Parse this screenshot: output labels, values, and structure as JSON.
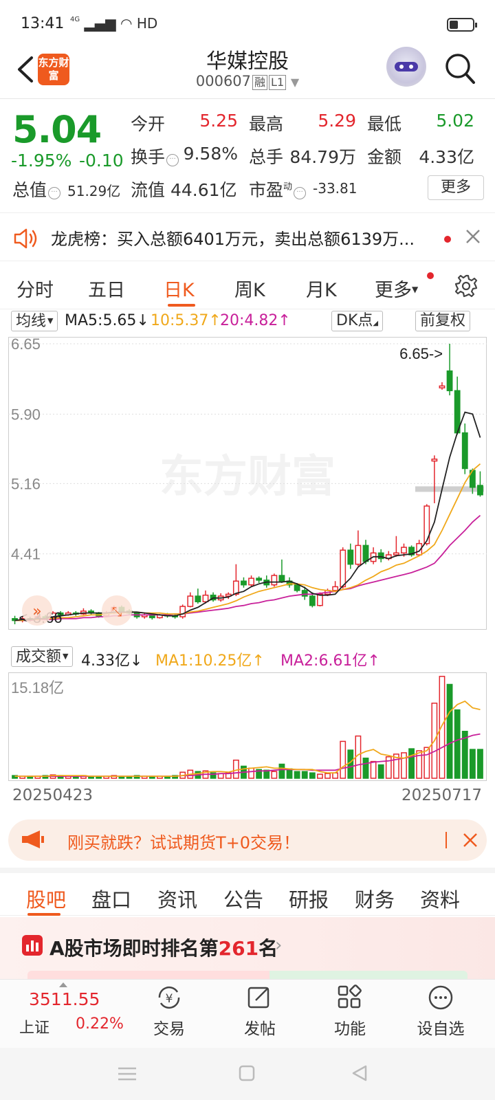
{
  "status_bar": {
    "time": "13:41",
    "network": "4G",
    "hd": "HD"
  },
  "header": {
    "logo_text": "东方财富",
    "stock_name": "华媒控股",
    "stock_code": "000607",
    "tag_rong": "融",
    "tag_level": "L1"
  },
  "quote": {
    "price": "5.04",
    "change_pct": "-1.95%",
    "change": "-0.10",
    "open_label": "今开",
    "open": "5.25",
    "high_label": "最高",
    "high": "5.29",
    "low_label": "最低",
    "low": "5.02",
    "turnover_label": "换手",
    "turnover": "9.58%",
    "volume_label": "总手",
    "volume": "84.79万",
    "amount_label": "金额",
    "amount": "4.33亿",
    "mktcap_label": "总值",
    "mktcap": "51.29亿",
    "float_label": "流值",
    "float_cap": "44.61亿",
    "pe_label": "市盈",
    "pe_sup": "动",
    "pe": "-33.81",
    "more_label": "更多"
  },
  "news": {
    "text": "龙虎榜：买入总额6401万元，卖出总额6139万..."
  },
  "period_tabs": [
    "分时",
    "五日",
    "日K",
    "周K",
    "月K",
    "更多"
  ],
  "ma_bar": {
    "indicator": "均线",
    "ma5": "MA5:5.65",
    "ma10": "10:5.37",
    "ma20": "20:4.82",
    "dk": "DK点",
    "adjust": "前复权",
    "ma5_color": "#222222",
    "ma10_color": "#f0a81a",
    "ma20_color": "#c8209a"
  },
  "chart": {
    "y_labels": [
      "6.65",
      "5.90",
      "5.16",
      "4.41"
    ],
    "max_label": "6.65",
    "min_label": "3.66",
    "watermark": "东方财富"
  },
  "volume_bar": {
    "indicator": "成交额",
    "value": "4.33亿",
    "ma1": "MA1:10.25亿",
    "ma2": "MA2:6.61亿",
    "max_label": "15.18亿"
  },
  "chart_data": {
    "type": "candlestick",
    "x_start": "20250423",
    "x_end": "20250717",
    "ylim": [
      3.66,
      6.65
    ],
    "candles": [
      [
        3.72,
        3.7,
        3.75,
        3.66
      ],
      [
        3.7,
        3.72,
        3.74,
        3.68
      ],
      [
        3.72,
        3.71,
        3.74,
        3.69
      ],
      [
        3.71,
        3.74,
        3.76,
        3.7
      ],
      [
        3.74,
        3.73,
        3.76,
        3.71
      ],
      [
        3.73,
        3.78,
        3.8,
        3.72
      ],
      [
        3.78,
        3.76,
        3.8,
        3.74
      ],
      [
        3.76,
        3.78,
        3.8,
        3.75
      ],
      [
        3.78,
        3.77,
        3.8,
        3.75
      ],
      [
        3.77,
        3.8,
        3.83,
        3.76
      ],
      [
        3.8,
        3.78,
        3.82,
        3.76
      ],
      [
        3.78,
        3.75,
        3.79,
        3.73
      ],
      [
        3.75,
        3.78,
        3.8,
        3.74
      ],
      [
        3.78,
        3.84,
        3.86,
        3.77
      ],
      [
        3.84,
        3.8,
        3.86,
        3.78
      ],
      [
        3.8,
        3.78,
        3.82,
        3.76
      ],
      [
        3.78,
        3.74,
        3.79,
        3.72
      ],
      [
        3.74,
        3.76,
        3.78,
        3.72
      ],
      [
        3.76,
        3.73,
        3.78,
        3.71
      ],
      [
        3.73,
        3.76,
        3.77,
        3.72
      ],
      [
        3.76,
        3.75,
        3.78,
        3.73
      ],
      [
        3.75,
        3.74,
        3.77,
        3.72
      ],
      [
        3.74,
        3.85,
        3.87,
        3.72
      ],
      [
        3.85,
        3.96,
        4.0,
        3.84
      ],
      [
        3.96,
        3.9,
        4.04,
        3.88
      ],
      [
        3.9,
        3.97,
        4.02,
        3.88
      ],
      [
        3.97,
        3.92,
        4.0,
        3.9
      ],
      [
        3.92,
        3.96,
        3.99,
        3.9
      ],
      [
        3.96,
        3.98,
        4.0,
        3.93
      ],
      [
        3.98,
        4.12,
        4.3,
        3.96
      ],
      [
        4.12,
        4.08,
        4.16,
        4.05
      ],
      [
        4.08,
        4.15,
        4.18,
        4.06
      ],
      [
        4.15,
        4.13,
        4.17,
        4.1
      ],
      [
        4.13,
        4.08,
        4.18,
        4.05
      ],
      [
        4.08,
        4.18,
        4.2,
        4.06
      ],
      [
        4.18,
        4.12,
        4.35,
        4.1
      ],
      [
        4.12,
        4.08,
        4.16,
        4.05
      ],
      [
        4.08,
        4.02,
        4.1,
        4.0
      ],
      [
        4.02,
        3.96,
        4.06,
        3.92
      ],
      [
        3.96,
        3.86,
        4.0,
        3.84
      ],
      [
        3.86,
        3.98,
        4.0,
        3.85
      ],
      [
        3.98,
        4.02,
        4.04,
        3.96
      ],
      [
        4.02,
        4.06,
        4.12,
        4.0
      ],
      [
        4.06,
        4.45,
        4.48,
        4.04
      ],
      [
        4.45,
        4.3,
        4.52,
        4.25
      ],
      [
        4.3,
        4.5,
        4.66,
        4.28
      ],
      [
        4.5,
        4.33,
        4.56,
        4.3
      ],
      [
        4.33,
        4.42,
        4.48,
        4.3
      ],
      [
        4.42,
        4.36,
        4.46,
        4.32
      ],
      [
        4.36,
        4.4,
        4.44,
        4.34
      ],
      [
        4.4,
        4.42,
        4.6,
        4.38
      ],
      [
        4.42,
        4.48,
        4.52,
        4.38
      ],
      [
        4.48,
        4.4,
        4.5,
        4.38
      ],
      [
        4.4,
        4.52,
        4.56,
        4.4
      ],
      [
        4.52,
        4.92,
        4.94,
        4.5
      ],
      [
        5.4,
        5.42,
        5.46,
        4.95
      ],
      [
        6.18,
        6.2,
        6.24,
        6.16
      ],
      [
        6.36,
        6.15,
        6.65,
        6.1
      ],
      [
        6.15,
        5.7,
        6.3,
        5.68
      ],
      [
        5.7,
        5.32,
        5.8,
        5.26
      ],
      [
        5.3,
        5.12,
        5.32,
        5.05
      ],
      [
        5.14,
        5.04,
        5.29,
        5.02
      ]
    ],
    "ma5": [
      3.7,
      3.71,
      3.71,
      3.72,
      3.72,
      3.74,
      3.75,
      3.76,
      3.77,
      3.78,
      3.78,
      3.78,
      3.78,
      3.79,
      3.79,
      3.79,
      3.79,
      3.78,
      3.77,
      3.76,
      3.75,
      3.75,
      3.77,
      3.81,
      3.84,
      3.89,
      3.94,
      3.94,
      3.95,
      3.99,
      4.01,
      4.06,
      4.09,
      4.11,
      4.11,
      4.11,
      4.12,
      4.09,
      4.05,
      3.99,
      3.97,
      3.97,
      3.98,
      4.07,
      4.15,
      4.27,
      4.33,
      4.38,
      4.38,
      4.36,
      4.39,
      4.4,
      4.41,
      4.44,
      4.55,
      4.75,
      5.1,
      5.44,
      5.7,
      5.92,
      5.9,
      5.65
    ],
    "ma10": [
      3.7,
      3.7,
      3.71,
      3.71,
      3.72,
      3.72,
      3.73,
      3.73,
      3.74,
      3.75,
      3.76,
      3.76,
      3.77,
      3.78,
      3.78,
      3.79,
      3.79,
      3.78,
      3.78,
      3.78,
      3.77,
      3.77,
      3.77,
      3.79,
      3.8,
      3.82,
      3.84,
      3.86,
      3.88,
      3.91,
      3.95,
      3.98,
      4.01,
      4.03,
      4.05,
      4.07,
      4.09,
      4.09,
      4.08,
      4.05,
      4.03,
      4.02,
      4.01,
      4.03,
      4.05,
      4.08,
      4.13,
      4.17,
      4.22,
      4.25,
      4.29,
      4.31,
      4.35,
      4.39,
      4.44,
      4.51,
      4.66,
      4.83,
      5.0,
      5.17,
      5.3,
      5.37
    ],
    "ma20": [
      3.7,
      3.7,
      3.7,
      3.71,
      3.71,
      3.71,
      3.72,
      3.72,
      3.72,
      3.73,
      3.73,
      3.74,
      3.74,
      3.75,
      3.75,
      3.76,
      3.76,
      3.76,
      3.76,
      3.76,
      3.76,
      3.77,
      3.77,
      3.78,
      3.79,
      3.8,
      3.81,
      3.82,
      3.83,
      3.85,
      3.86,
      3.88,
      3.89,
      3.91,
      3.92,
      3.94,
      3.96,
      3.97,
      3.98,
      3.98,
      3.99,
      4.0,
      4.01,
      4.03,
      4.04,
      4.07,
      4.09,
      4.11,
      4.13,
      4.15,
      4.17,
      4.19,
      4.21,
      4.24,
      4.27,
      4.31,
      4.4,
      4.5,
      4.58,
      4.66,
      4.75,
      4.82
    ],
    "volume": {
      "max": 15.18,
      "values": [
        0.4,
        0.3,
        0.3,
        0.3,
        0.4,
        0.5,
        0.4,
        0.3,
        0.3,
        0.4,
        0.3,
        0.3,
        0.3,
        0.4,
        0.3,
        0.3,
        0.4,
        0.3,
        0.3,
        0.3,
        0.3,
        0.4,
        0.9,
        1.2,
        1.0,
        1.1,
        0.8,
        0.7,
        0.8,
        2.7,
        1.8,
        1.5,
        1.3,
        1.2,
        1.0,
        2.1,
        1.4,
        1.0,
        1.0,
        0.8,
        0.6,
        0.7,
        0.8,
        5.5,
        4.2,
        6.3,
        3.0,
        2.5,
        2.0,
        3.2,
        3.6,
        3.8,
        4.4,
        4.1,
        4.6,
        11.2,
        15.2,
        14.0,
        10.2,
        7.0,
        4.3,
        4.3
      ],
      "ma1": [
        0.3,
        0.3,
        0.3,
        0.3,
        0.3,
        0.4,
        0.4,
        0.4,
        0.4,
        0.4,
        0.3,
        0.3,
        0.3,
        0.3,
        0.3,
        0.3,
        0.3,
        0.3,
        0.3,
        0.3,
        0.3,
        0.3,
        0.4,
        0.6,
        0.7,
        0.9,
        1.0,
        1.0,
        0.9,
        1.2,
        1.4,
        1.5,
        1.6,
        1.7,
        1.5,
        1.5,
        1.4,
        1.3,
        1.3,
        1.3,
        1.0,
        0.8,
        0.8,
        1.7,
        2.4,
        3.5,
        4.0,
        4.3,
        3.6,
        3.4,
        3.1,
        3.0,
        3.4,
        3.8,
        4.1,
        5.6,
        7.9,
        9.9,
        11.0,
        11.5,
        10.5,
        10.25
      ],
      "ma2": [
        0.3,
        0.3,
        0.3,
        0.3,
        0.3,
        0.3,
        0.3,
        0.3,
        0.3,
        0.3,
        0.3,
        0.3,
        0.3,
        0.3,
        0.3,
        0.3,
        0.3,
        0.3,
        0.3,
        0.3,
        0.3,
        0.3,
        0.4,
        0.4,
        0.5,
        0.6,
        0.6,
        0.7,
        0.7,
        0.8,
        0.9,
        1.0,
        1.1,
        1.1,
        1.2,
        1.3,
        1.3,
        1.3,
        1.3,
        1.2,
        1.2,
        1.2,
        1.2,
        1.5,
        1.7,
        2.0,
        2.2,
        2.4,
        2.5,
        2.6,
        2.8,
        3.0,
        3.2,
        3.4,
        3.5,
        4.0,
        4.6,
        5.2,
        5.7,
        6.0,
        6.4,
        6.61
      ]
    }
  },
  "dates": {
    "start": "20250423",
    "end": "20250717"
  },
  "promo": {
    "text": "刚买就跌？试试期货T+0交易！"
  },
  "section_tabs": [
    "股吧",
    "盘口",
    "资讯",
    "公告",
    "研报",
    "财务",
    "资料"
  ],
  "ranking": {
    "prefix": "A股市场即时排名第",
    "rank": "261",
    "suffix": "名"
  },
  "bottom": {
    "index_value": "3511.55",
    "index_name": "上证",
    "index_pct": "0.22%",
    "nav": [
      "交易",
      "发帖",
      "功能",
      "设自选"
    ]
  },
  "colors": {
    "up": "#e3262d",
    "down": "#1a9a2a",
    "accent": "#ef5a1e"
  }
}
